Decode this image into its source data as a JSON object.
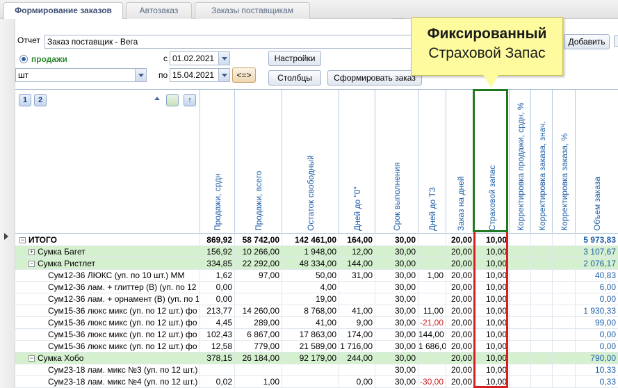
{
  "tabs": [
    {
      "label": "Формирование заказов",
      "active": true
    },
    {
      "label": "Автозаказ",
      "active": false
    },
    {
      "label": "Заказы поставщикам",
      "active": false
    }
  ],
  "report": {
    "label": "Отчет",
    "value": "Заказ поставщик - Вега"
  },
  "sales_radio": {
    "label": "продажи"
  },
  "unit_select": {
    "value": "шт"
  },
  "date_from": {
    "label": "с",
    "value": "01.02.2021"
  },
  "date_to": {
    "label": "по",
    "value": "15.04.2021"
  },
  "swap_button": "<=>",
  "buttons": {
    "settings": "Настройки",
    "columns": "Столбцы",
    "build_order": "Сформировать заказ",
    "add": "Добавить"
  },
  "callout": {
    "line1": "Фиксированный",
    "line2": "Страховой Запас"
  },
  "grid": {
    "group_buttons": [
      "1",
      "2"
    ],
    "columns": [
      "Продажи, срдн",
      "Продажи, всего",
      "Остаток свободный",
      "Дней до \"0\"",
      "Срок выполнения",
      "Дней до ТЗ",
      "Заказ на дней",
      "Страховой запас",
      "Корректировка продажи, срдн, %",
      "Корректировка заказа, знач.",
      "Корректировка заказа, %",
      "Объем заказа"
    ],
    "rows": [
      {
        "name": "ИТОГО",
        "level": 0,
        "type": "total",
        "expander": "−",
        "values": [
          "869,92",
          "58 742,00",
          "142 461,00",
          "164,00",
          "30,00",
          "",
          "20,00",
          "10,00",
          "",
          "",
          "",
          "5 973,83"
        ]
      },
      {
        "name": "Сумка Багет",
        "level": 1,
        "type": "group",
        "expander": "+",
        "values": [
          "156,92",
          "10 266,00",
          "1 948,00",
          "12,00",
          "30,00",
          "",
          "20,00",
          "10,00",
          "",
          "",
          "",
          "3 107,67"
        ]
      },
      {
        "name": "Сумка Ристлет",
        "level": 1,
        "type": "group",
        "expander": "−",
        "values": [
          "334,85",
          "22 292,00",
          "48 334,00",
          "144,00",
          "30,00",
          "",
          "20,00",
          "10,00",
          "",
          "",
          "",
          "2 076,17"
        ]
      },
      {
        "name": "Сум12-36 ЛЮКС (уп. по 10 шт.) ММ",
        "level": 2,
        "type": "item",
        "values": [
          "1,62",
          "97,00",
          "50,00",
          "31,00",
          "30,00",
          "1,00",
          "20,00",
          "10,00",
          "",
          "",
          "",
          "40,83"
        ]
      },
      {
        "name": "Сум12-36 лам. + глиттер (В) (уп. по 12",
        "level": 2,
        "type": "item",
        "values": [
          "0,00",
          "",
          "4,00",
          "",
          "30,00",
          "",
          "20,00",
          "10,00",
          "",
          "",
          "",
          "6,00"
        ]
      },
      {
        "name": "Сум12-36 лам. + орнамент (В) (уп. по 1",
        "level": 2,
        "type": "item",
        "values": [
          "0,00",
          "",
          "19,00",
          "",
          "30,00",
          "",
          "20,00",
          "10,00",
          "",
          "",
          "",
          "0,00"
        ]
      },
      {
        "name": "Сум15-36 люкс микс (уп. по 12 шт.) фо",
        "level": 2,
        "type": "item",
        "values": [
          "213,77",
          "14 260,00",
          "8 768,00",
          "41,00",
          "30,00",
          "11,00",
          "20,00",
          "10,00",
          "",
          "",
          "",
          "1 930,33"
        ]
      },
      {
        "name": "Сум15-36 люкс микс (уп. по 12 шт.) фо",
        "level": 2,
        "type": "item",
        "values": [
          "4,45",
          "289,00",
          "41,00",
          "9,00",
          "30,00",
          "-21,00",
          "20,00",
          "10,00",
          "",
          "",
          "",
          "99,00"
        ]
      },
      {
        "name": "Сум15-36 люкс микс (уп. по 12 шт.) фо",
        "level": 2,
        "type": "item",
        "values": [
          "102,43",
          "6 867,00",
          "17 863,00",
          "174,00",
          "30,00",
          "144,00",
          "20,00",
          "10,00",
          "",
          "",
          "",
          "0,00"
        ]
      },
      {
        "name": "Сум15-36 люкс микс (уп. по 12 шт.) фо",
        "level": 2,
        "type": "item",
        "values": [
          "12,58",
          "779,00",
          "21 589,00",
          "1 716,00",
          "30,00",
          "1 686,00",
          "20,00",
          "10,00",
          "",
          "",
          "",
          "0,00"
        ]
      },
      {
        "name": "Сумка Хобо",
        "level": 1,
        "type": "group",
        "expander": "−",
        "values": [
          "378,15",
          "26 184,00",
          "92 179,00",
          "244,00",
          "30,00",
          "",
          "20,00",
          "10,00",
          "",
          "",
          "",
          "790,00"
        ]
      },
      {
        "name": "Сум23-18 лам. микс №3 (уп. по 12 шт.)",
        "level": 2,
        "type": "item",
        "values": [
          "",
          "",
          "",
          "",
          "30,00",
          "",
          "20,00",
          "10,00",
          "",
          "",
          "",
          "10,33"
        ]
      },
      {
        "name": "Сум23-18 лам. микс №4 (уп. по 12 шт.)",
        "level": 2,
        "type": "item",
        "values": [
          "0,02",
          "1,00",
          "",
          "0,00",
          "30,00",
          "-30,00",
          "20,00",
          "10,00",
          "",
          "",
          "",
          "0,33"
        ]
      }
    ]
  },
  "colors": {
    "accent": "#1f5fa8",
    "group_row": "#d5f0cf",
    "negative": "#d02020",
    "green_frame": "#1f7a1f",
    "red_frame": "#d42020"
  }
}
